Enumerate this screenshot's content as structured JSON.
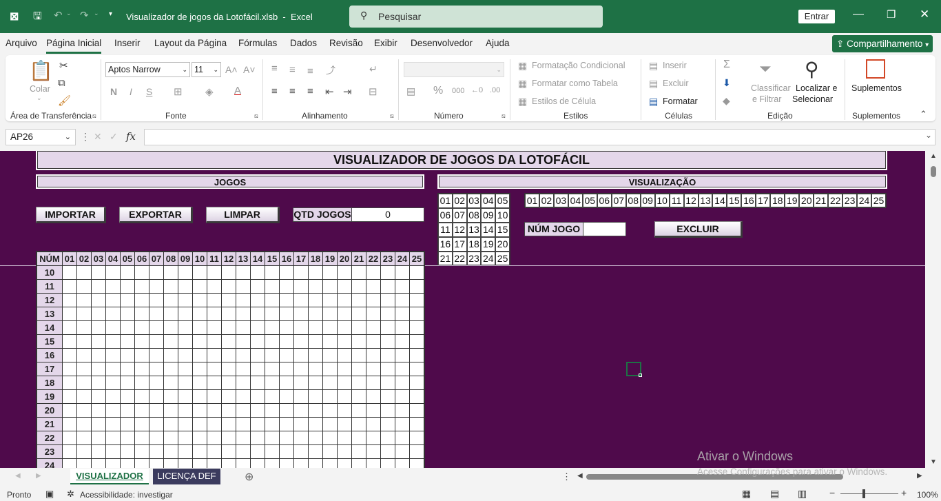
{
  "titlebar": {
    "doc_title": "Visualizador de jogos da Lotofácil.xlsb",
    "separator": "-",
    "app": "Excel",
    "search_placeholder": "Pesquisar",
    "signin": "Entrar"
  },
  "menu": {
    "items": [
      "Arquivo",
      "Página Inicial",
      "Inserir",
      "Layout da Página",
      "Fórmulas",
      "Dados",
      "Revisão",
      "Exibir",
      "Desenvolvedor",
      "Ajuda"
    ],
    "active": "Página Inicial",
    "share": "Compartilhamento"
  },
  "ribbon": {
    "clipboard": {
      "paste": "Colar",
      "label": "Área de Transferência"
    },
    "font": {
      "family": "Aptos Narrow",
      "size": "11",
      "bold": "N",
      "italic": "I",
      "underline": "S",
      "label": "Fonte"
    },
    "alignment": {
      "label": "Alinhamento"
    },
    "number": {
      "format": "",
      "label": "Número"
    },
    "styles": {
      "conditional": "Formatação Condicional",
      "table": "Formatar como Tabela",
      "cell_styles": "Estilos de Célula",
      "label": "Estilos"
    },
    "cells": {
      "insert": "Inserir",
      "delete": "Excluir",
      "format": "Formatar",
      "label": "Células"
    },
    "editing": {
      "sort_1": "Classificar",
      "sort_2": "e Filtrar",
      "find_1": "Localizar e",
      "find_2": "Selecionar",
      "label": "Edição"
    },
    "addins": {
      "button": "Suplementos",
      "label": "Suplementos"
    }
  },
  "formula_bar": {
    "name_box": "AP26",
    "fx": "fx",
    "content": ""
  },
  "sheet": {
    "title": "VISUALIZADOR DE JOGOS DA LOTOFÁCIL",
    "jogos_header": "JOGOS",
    "visualizacao_header": "VISUALIZAÇÃO",
    "buttons": {
      "importar": "IMPORTAR",
      "exportar": "EXPORTAR",
      "limpar": "LIMPAR",
      "excluir": "EXCLUIR"
    },
    "qtd_label": "QTD JOGOS",
    "qtd_value": "0",
    "num_jogo_label": "NÚM JOGO",
    "num_jogo_value": "",
    "number_grid": [
      "01",
      "02",
      "03",
      "04",
      "05",
      "06",
      "07",
      "08",
      "09",
      "10",
      "11",
      "12",
      "13",
      "14",
      "15",
      "16",
      "17",
      "18",
      "19",
      "20",
      "21",
      "22",
      "23",
      "24",
      "25"
    ],
    "number_strip": [
      "01",
      "02",
      "03",
      "04",
      "05",
      "06",
      "07",
      "08",
      "09",
      "10",
      "11",
      "12",
      "13",
      "14",
      "15",
      "16",
      "17",
      "18",
      "19",
      "20",
      "21",
      "22",
      "23",
      "24",
      "25"
    ],
    "table_header_first": "NÚM",
    "table_columns": [
      "01",
      "02",
      "03",
      "04",
      "05",
      "06",
      "07",
      "08",
      "09",
      "10",
      "11",
      "12",
      "13",
      "14",
      "15",
      "16",
      "17",
      "18",
      "19",
      "20",
      "21",
      "22",
      "23",
      "24",
      "25"
    ],
    "row_numbers": [
      "10",
      "11",
      "12",
      "13",
      "14",
      "15",
      "16",
      "17",
      "18",
      "19",
      "20",
      "21",
      "22",
      "23",
      "24"
    ]
  },
  "watermark": {
    "line1": "Ativar o Windows",
    "line2": "Acesse Configurações para ativar o Windows."
  },
  "tabs": {
    "sheets": [
      "VISUALIZADOR",
      "LICENÇA DEF"
    ],
    "active": "VISUALIZADOR"
  },
  "status": {
    "ready": "Pronto",
    "accessibility": "Acessibilidade: investigar",
    "zoom": "100%"
  },
  "colors": {
    "excel_green": "#1e7145",
    "sheet_bg": "#4f0a4b",
    "label_fill": "#e4d7ea"
  }
}
